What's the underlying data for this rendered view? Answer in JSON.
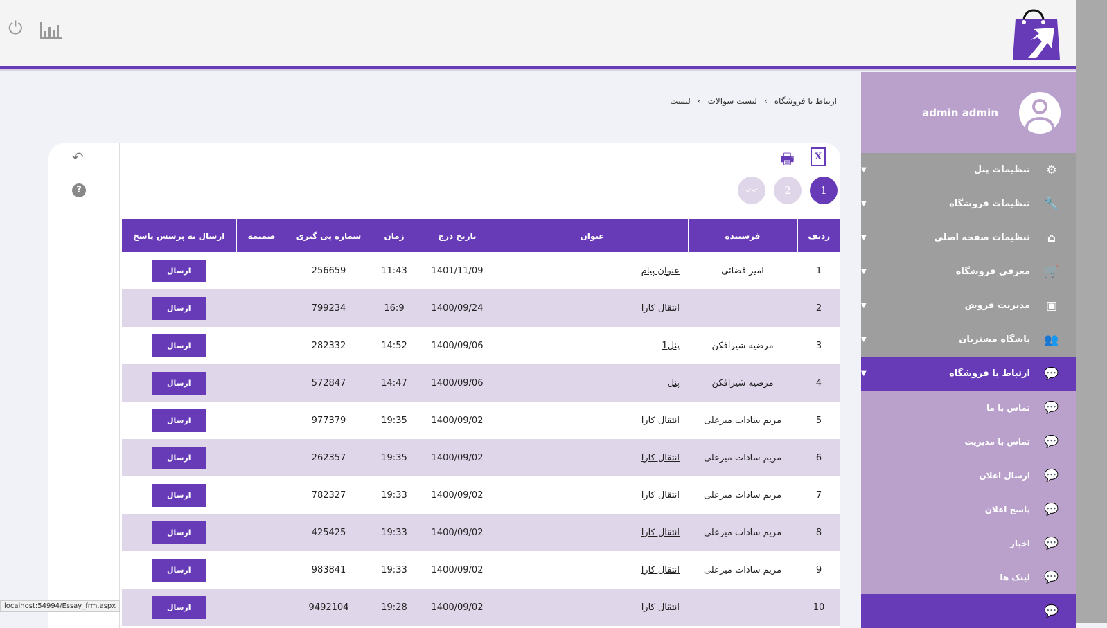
{
  "header": {
    "icons": [
      "power-icon",
      "bar-chart-icon"
    ]
  },
  "profile": {
    "name": "admin admin"
  },
  "menu": [
    {
      "label": "تنظیمات پنل",
      "icon": "⚙"
    },
    {
      "label": "تنظیمات فروشگاه",
      "icon": "🔧"
    },
    {
      "label": "تنظیمات صفحه اصلی",
      "icon": "⌂"
    },
    {
      "label": "معرفی فروشگاه",
      "icon": "🛒"
    },
    {
      "label": "مدیریت فروش",
      "icon": "▣"
    },
    {
      "label": "باشگاه مشتریان",
      "icon": "👥"
    },
    {
      "label": "ارتباط با فروشگاه",
      "icon": "💬"
    }
  ],
  "submenu": [
    "تماس با ما",
    "تماس با مدیریت",
    "ارسال اعلان",
    "پاسخ اعلان",
    "اخبار",
    "لینک ها"
  ],
  "breadcrumb": [
    "ارتباط با فروشگاه",
    "لیست سوالات",
    "لیست"
  ],
  "pagination": {
    "pages": [
      "1",
      "2"
    ],
    "prev": "<<"
  },
  "table": {
    "headers": [
      "ردیف",
      "فرستنده",
      "عنوان",
      "تاریخ درج",
      "زمان",
      "شماره پی گیری",
      "ضمیمه",
      "ارسال به پرسش پاسخ"
    ],
    "button": "ارسال",
    "rows": [
      [
        "1",
        "امیر قضائی",
        "عنوان پیام",
        "1401/11/09",
        "11:43",
        "256659"
      ],
      [
        "2",
        "",
        "انتقال کارا",
        "1400/09/24",
        "16:9",
        "799234"
      ],
      [
        "3",
        "مرضیه شیرافکن",
        "پنل1",
        "1400/09/06",
        "14:52",
        "282332"
      ],
      [
        "4",
        "مرضیه شیرافکن",
        "پنل",
        "1400/09/06",
        "14:47",
        "572847"
      ],
      [
        "5",
        "مریم سادات میرعلی",
        "انتقال کارا",
        "1400/09/02",
        "19:35",
        "977379"
      ],
      [
        "6",
        "مریم سادات میرعلی",
        "انتقال کارا",
        "1400/09/02",
        "19:35",
        "262357"
      ],
      [
        "7",
        "مریم سادات میرعلی",
        "انتقال کارا",
        "1400/09/02",
        "19:33",
        "782327"
      ],
      [
        "8",
        "مریم سادات میرعلی",
        "انتقال کارا",
        "1400/09/02",
        "19:33",
        "425425"
      ],
      [
        "9",
        "مریم سادات میرعلی",
        "انتقال کارا",
        "1400/09/02",
        "19:33",
        "983841"
      ],
      [
        "10",
        "",
        "انتقال کارا",
        "1400/09/02",
        "19:28",
        "9492104"
      ]
    ]
  },
  "status_bar": "localhost:54994/Essay_frm.aspx"
}
